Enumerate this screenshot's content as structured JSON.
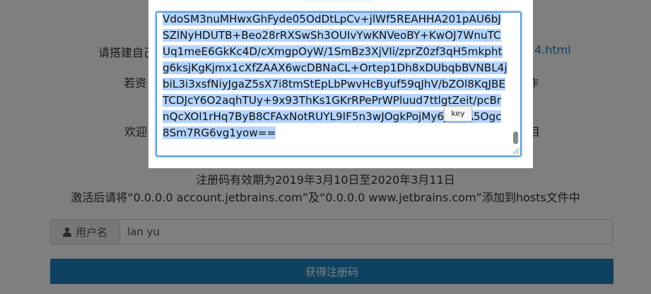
{
  "background": {
    "line1_prefix": "请搭建自己",
    "line1_link_suffix": "4.html",
    "line2_prefix": "若资",
    "line2_suffix": "作",
    "line3_prefix": "欢迎",
    "line3_suffix": "目",
    "validity": "注册码有效期为2019年3月10日至2020年3月11日",
    "hosts_note": "激活后请将“0.0.0.0 account.jetbrains.com”及“0.0.0.0 www.jetbrains.com”添加到hosts文件中"
  },
  "form": {
    "username_label": "用户名",
    "username_value": "lan yu",
    "submit_label": "获得注册码"
  },
  "modal": {
    "key_text": "VdoSM3nuMHwxGhFyde05OdDtLpCv+jlWf5REAHHA201pAU6bJSZlNyHDUTB+Beo28rRXSwSh3OUIvYwKNVeoBY+KwOJ7WnuTCUq1meE6GkKc4D/cXmgpOyW/1SmBz3XjVIi/zprZ0zf3qH5mkphtg6ksjKgKjmx1cXfZAAX6wcDBNaCL+Ortep1Dh8xDUbqbBVNBL4jbiL3i3xsfNiyJgaZ5sX7i8tmStEpLbPwvHcByuf59qJhV/bZOl8KqJBETCDJcY6O2aqhTUy+9x93ThKs1GKrRPePrWPluud7ttlgtZeit/pcBrnQcXOl1rHq7ByB8CFAxNotRUYL9IF5n3wJOgkPojMy6jetQA5Ogc8Sm7RG6vg1yow==",
    "tooltip": "key"
  },
  "colors": {
    "accent": "#1f84c2",
    "selection": "#b3d4fd",
    "focus_border": "#5b9dd9"
  }
}
